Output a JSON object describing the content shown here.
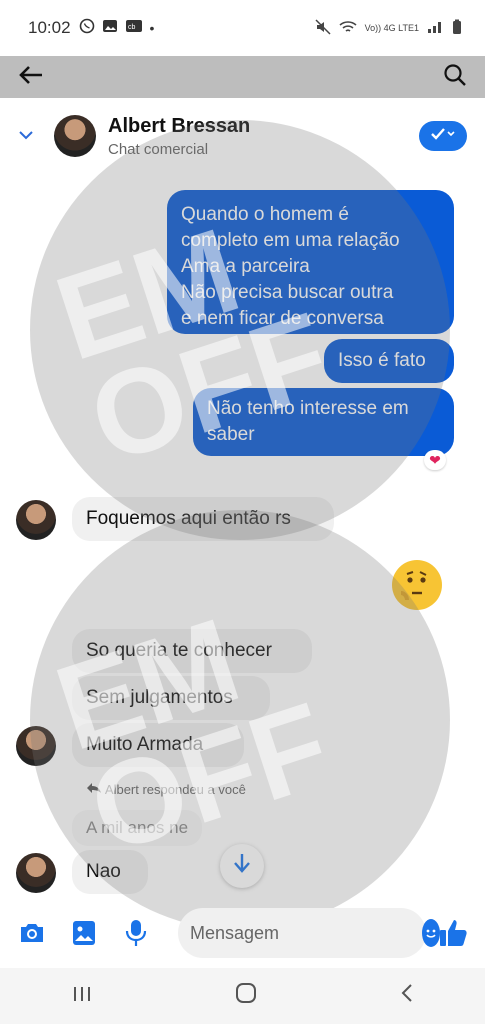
{
  "status": {
    "time": "10:02",
    "net": "Vo)) 4G LTE1"
  },
  "topbar": {
    "back_icon": "arrow-left-icon",
    "search_icon": "search-icon"
  },
  "chat": {
    "contact_name": "Albert Bressan",
    "contact_subtitle": "Chat comercial"
  },
  "messages": {
    "out_1": [
      "Quando o homem é",
      "completo em uma relação",
      "Ama a parceira",
      "Não precisa buscar outra",
      "e nem ficar de conversa"
    ],
    "out_2": "Isso é fato",
    "out_3": [
      "Não tenho interesse em",
      "saber"
    ],
    "reaction": "❤",
    "in_1": "Foquemos aqui então rs",
    "in_2": "So queria te conhecer",
    "in_3": "Sem julgamentos",
    "in_4": "Muito Armada",
    "reply_note": "Albert respondeu a você",
    "reply_quote": "A mil anos ne",
    "in_5": "Nao"
  },
  "composer": {
    "placeholder": "Mensagem"
  },
  "watermark": {
    "text": "EM OFF"
  },
  "colors": {
    "outgoing": "#0a5bd6",
    "incoming": "#f0f0f0",
    "accent": "#1a73e8"
  }
}
